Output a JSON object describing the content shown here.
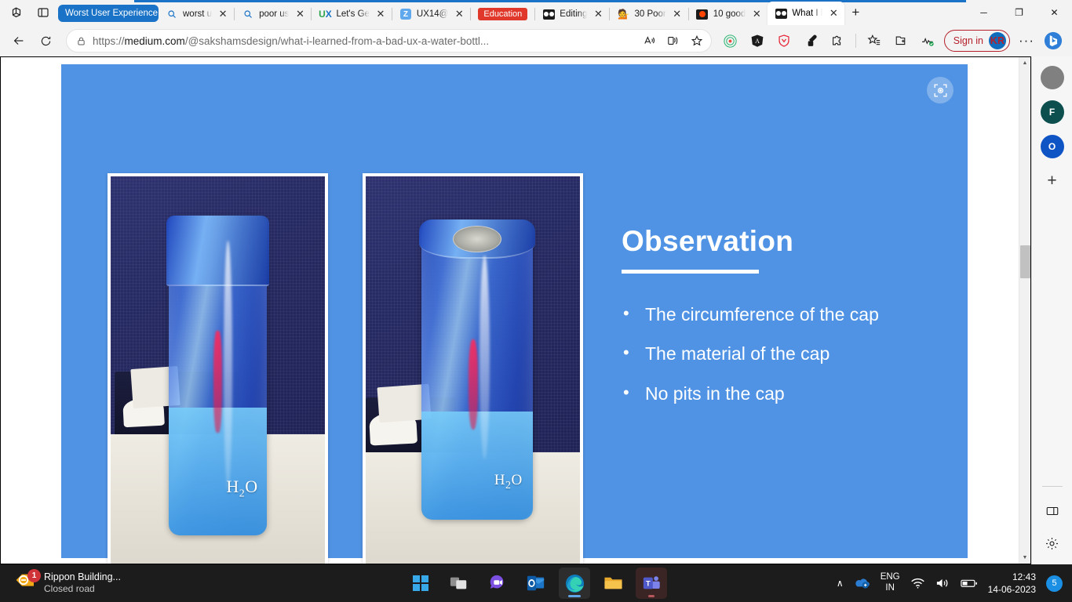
{
  "browser": {
    "tab_group": {
      "label": "Worst User Experience",
      "color": "#1a73c7"
    },
    "tabs": [
      {
        "title": "worst u",
        "icon": "search-icon",
        "active": false
      },
      {
        "title": "poor us",
        "icon": "search-icon",
        "active": false
      },
      {
        "title": "Let's Ge",
        "icon": "ux-logo-icon",
        "active": false
      },
      {
        "title": "UX14@",
        "icon": "zoom-icon",
        "active": false
      },
      {
        "title": "Education",
        "icon": "education-badge-icon",
        "active": false
      },
      {
        "title": "Editing",
        "icon": "slideshare-icon",
        "active": false
      },
      {
        "title": "30 Poor",
        "icon": "emoji-icon",
        "active": false
      },
      {
        "title": "10 good",
        "icon": "youtube-icon",
        "active": false
      },
      {
        "title": "What I l",
        "icon": "slideshare-icon",
        "active": true
      }
    ],
    "new_tab_label": "+",
    "window_controls": {
      "minimize": "─",
      "maximize": "❐",
      "close": "✕"
    },
    "nav": {
      "back": "←",
      "refresh": "⟳"
    },
    "address": {
      "lock_icon": "lock-icon",
      "url_prefix": "https://",
      "url_domain": "medium.com",
      "url_path": "/@sakshamsdesign/what-i-learned-from-a-bad-ux-a-water-bottl...",
      "url_full": "https://medium.com/@sakshamsdesign/what-i-learned-from-a-bad-ux-a-water-bottl..."
    },
    "toolbar_icons": [
      "read-aloud-icon",
      "immersive-reader-icon",
      "favorite-star-icon"
    ],
    "extensions": [
      "extension-circles-icon",
      "angular-icon",
      "adguard-shield-icon",
      "eyedropper-icon",
      "puzzle-icon"
    ],
    "actions": [
      "collections-icon",
      "add-tab-to-collection-icon",
      "browser-essentials-icon"
    ],
    "sign_in": {
      "label": "Sign in",
      "avatar_initials": "KR",
      "avatar_color": "#0f6cbd",
      "border_color": "#b51f2a"
    },
    "settings_more": "···",
    "bing_button": "bing-chat-icon"
  },
  "sidebar": {
    "items": [
      {
        "name": "discover-avatar",
        "label": "",
        "color": "#808080"
      },
      {
        "name": "facebook-shortcut",
        "label": "F",
        "color": "#0d4f4f"
      },
      {
        "name": "outlook-shortcut",
        "label": "O",
        "color": "#0f54c4"
      },
      {
        "name": "add-site-button",
        "label": "+",
        "color": ""
      }
    ],
    "bottom": [
      {
        "name": "split-screen-icon",
        "label": ""
      },
      {
        "name": "sidebar-settings-icon",
        "label": ""
      }
    ]
  },
  "slide": {
    "background_color": "#5093e4",
    "title": "Observation",
    "bullets": [
      "The circumference of the cap",
      "The material of the cap",
      "No pits in the cap"
    ],
    "photos": [
      {
        "name": "water-bottle-front-photo",
        "alt": "Blue transparent H2O water bottle on a white desk in front of a navy office chair",
        "label": "H₂O"
      },
      {
        "name": "water-bottle-angled-photo",
        "alt": "Blue transparent water bottle viewed from above showing the metallic cap top",
        "label": "H₂O"
      }
    ],
    "visual_search_label": "visual-search-icon"
  },
  "scrollbar": {
    "up_arrow": "▲",
    "down_arrow": "▼"
  },
  "taskbar": {
    "widget": {
      "title": "Rippon Building...",
      "subtitle": "Closed road",
      "badge": "1"
    },
    "apps": [
      {
        "name": "start-button",
        "label": ""
      },
      {
        "name": "task-view-button",
        "label": ""
      },
      {
        "name": "teams-chat-button",
        "label": ""
      },
      {
        "name": "outlook-button",
        "label": ""
      },
      {
        "name": "edge-button",
        "label": "",
        "active": true
      },
      {
        "name": "file-explorer-button",
        "label": ""
      },
      {
        "name": "teams-button",
        "label": "",
        "open": true
      }
    ],
    "tray": {
      "overflow": "∧",
      "onedrive_icon": "onedrive-icon",
      "language": {
        "line1": "ENG",
        "line2": "IN"
      },
      "wifi_icon": "wifi-icon",
      "volume_icon": "volume-icon",
      "battery_icon": "battery-icon",
      "time": "12:43",
      "date": "14-06-2023",
      "notification_count": "5"
    }
  }
}
